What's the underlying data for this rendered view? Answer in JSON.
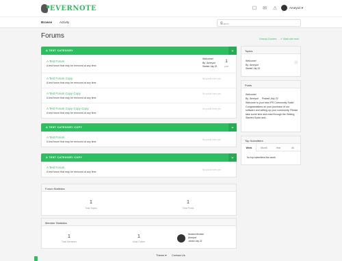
{
  "brand": {
    "name": "EVERNOTE"
  },
  "header": {
    "icons": [
      "bell-icon",
      "mail-icon",
      "warning-icon"
    ],
    "user_name": "Ameyuri ▾"
  },
  "subnav": {
    "items": [
      "Browse",
      "Activity"
    ],
    "search_placeholder": "Search"
  },
  "page": {
    "title": "Forums",
    "links": [
      "Unread Content",
      "✔ Mark site read"
    ]
  },
  "categories": [
    {
      "name": "A TEST CATEGORY",
      "forums": [
        {
          "title": "A Test Forum",
          "desc": "A test forum that may be removed at any time.",
          "count": "1",
          "count_label": "post",
          "last": {
            "title": "Welcome!",
            "by_prefix": "By",
            "by": "Ameyuri",
            "date": "Started July 22"
          }
        },
        {
          "title": "A Test Forum Copy",
          "desc": "A test forum that may be removed at any time.",
          "none": "No posts here yet"
        },
        {
          "title": "A Test Forum Copy Copy",
          "desc": "A test forum that may be removed at any time.",
          "none": "No posts here yet"
        },
        {
          "title": "A Test Forum Copy Copy Copy",
          "desc": "A test forum that may be removed at any time.",
          "none": "No posts here yet"
        }
      ]
    },
    {
      "name": "A TEST CATEGORY COPY",
      "forums": [
        {
          "title": "A Test Forum",
          "desc": "A test forum that may be removed at any time.",
          "none": "No posts here yet"
        }
      ]
    },
    {
      "name": "A TEST CATEGORY COPY",
      "forums": [
        {
          "title": "A Test Forum",
          "desc": "A test forum that may be removed at any time.",
          "none": "No posts here yet"
        }
      ]
    }
  ],
  "forum_stats": {
    "title": "Forum Statistics",
    "items": [
      {
        "value": "1",
        "label": "Total Topics"
      },
      {
        "value": "1",
        "label": "Total Posts"
      }
    ]
  },
  "member_stats": {
    "title": "Member Statistics",
    "items": [
      {
        "value": "1",
        "label": "Total Members"
      },
      {
        "value": "1",
        "label": "Most Online"
      }
    ],
    "newest": {
      "label": "Newest Member",
      "name": "Ameyuri",
      "date": "Joined July 22"
    }
  },
  "sidebar": {
    "topics": {
      "title": "Topics",
      "item_title": "Welcome!",
      "item_by_prefix": "By",
      "item_by": "Ameyuri",
      "item_date": "Started July 22"
    },
    "posts": {
      "title": "Posts",
      "item_title": "Welcome!",
      "item_by_prefix": "By",
      "item_by": "Ameyuri",
      "item_posted": "Posted July 22",
      "excerpt": "Welcome to your new IPS Community Suite! Congratulations on your purchase of our software and setting up your community. Please take some time and read through the Getting Started Guide and..."
    },
    "top_submitters": {
      "title": "Top Submitters",
      "tabs": [
        "Week",
        "Month",
        "Year",
        "All"
      ],
      "empty": "No top submitters this week."
    }
  },
  "footer": {
    "theme": "Theme ▾",
    "contact": "Contact Us"
  },
  "colors": {
    "accent": "#2dbe60",
    "accent_dark": "#27a955",
    "author": "#d9534f"
  }
}
